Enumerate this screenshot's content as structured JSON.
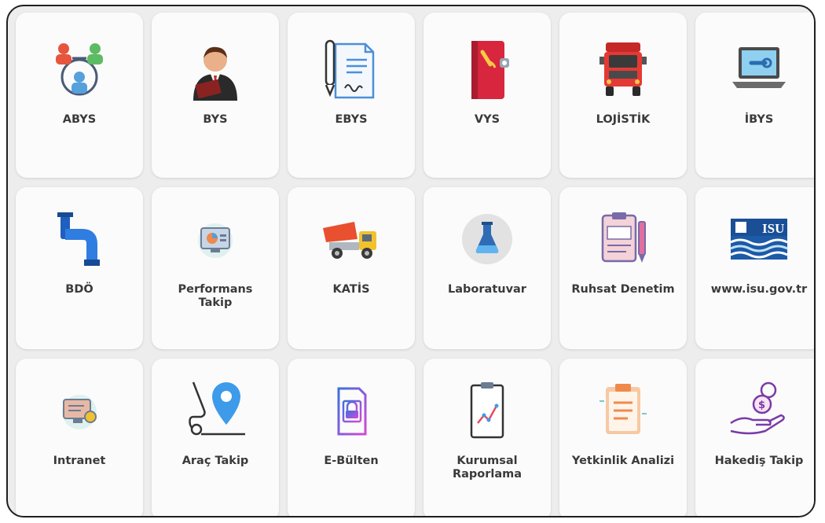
{
  "tiles": [
    {
      "label": "ABYS",
      "icon": "people-network-icon"
    },
    {
      "label": "BYS",
      "icon": "businessman-icon"
    },
    {
      "label": "EBYS",
      "icon": "signed-document-icon"
    },
    {
      "label": "VYS",
      "icon": "red-notebook-icon"
    },
    {
      "label": "LOJİSTİK",
      "icon": "truck-front-icon"
    },
    {
      "label": "İBYS",
      "icon": "laptop-wrench-icon"
    },
    {
      "label": "BDÖ",
      "icon": "pipe-icon"
    },
    {
      "label": "Performans\nTakip",
      "icon": "performance-monitor-icon"
    },
    {
      "label": "KATİS",
      "icon": "dump-truck-icon"
    },
    {
      "label": "Laboratuvar",
      "icon": "lab-flask-icon"
    },
    {
      "label": "Ruhsat Denetim",
      "icon": "clipboard-pen-icon"
    },
    {
      "label": "www.isu.gov.tr",
      "icon": "isu-logo-icon"
    },
    {
      "label": "Intranet",
      "icon": "intranet-icon"
    },
    {
      "label": "Araç Takip",
      "icon": "vehicle-location-icon"
    },
    {
      "label": "E-Bülten",
      "icon": "bulletin-icon"
    },
    {
      "label": "Kurumsal\nRaporlama",
      "icon": "report-chart-icon"
    },
    {
      "label": "Yetkinlik Analizi",
      "icon": "checklist-clipboard-icon"
    },
    {
      "label": "Hakediş Takip",
      "icon": "payment-hand-icon"
    }
  ]
}
